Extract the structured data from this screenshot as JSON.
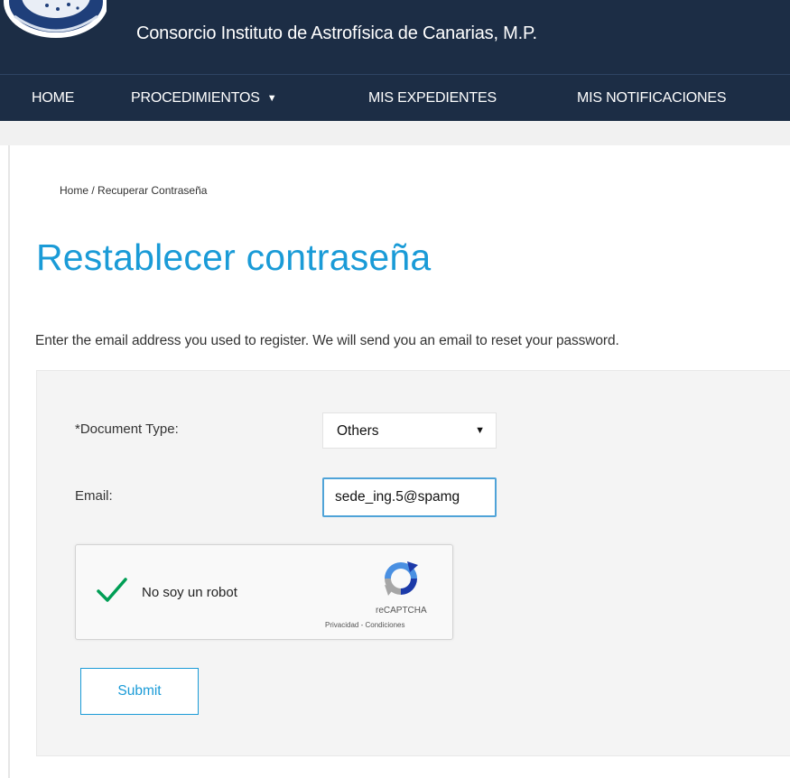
{
  "header": {
    "site_title": "Consorcio Instituto de Astrofísica de Canarias, M.P.",
    "logo_icon": "institution-seal-icon"
  },
  "nav": {
    "items": [
      {
        "label": "HOME"
      },
      {
        "label": "PROCEDIMIENTOS",
        "dropdown": true
      },
      {
        "label": "MIS EXPEDIENTES"
      },
      {
        "label": "MIS NOTIFICACIONES"
      }
    ],
    "caret": "▼"
  },
  "breadcrumb": {
    "home": "Home",
    "separator": " / ",
    "current": "Recuperar Contraseña"
  },
  "page_title": "Restablecer contraseña",
  "intro_text": "Enter the email address you used to register. We will send you an email to reset your password.",
  "form": {
    "document_type_label": "*Document Type:",
    "document_type_value": "Others",
    "select_arrow": "▼",
    "email_label": "Email:",
    "email_value": "sede_ing.5@spamg",
    "submit_label": "Submit"
  },
  "recaptcha": {
    "label": "No soy un robot",
    "brand": "reCAPTCHA",
    "privacy": "Privacidad",
    "separator": " - ",
    "terms": "Condiciones",
    "checked": true
  },
  "colors": {
    "header_bg": "#1c2d45",
    "accent": "#1a9bd7",
    "check": "#009e55"
  }
}
